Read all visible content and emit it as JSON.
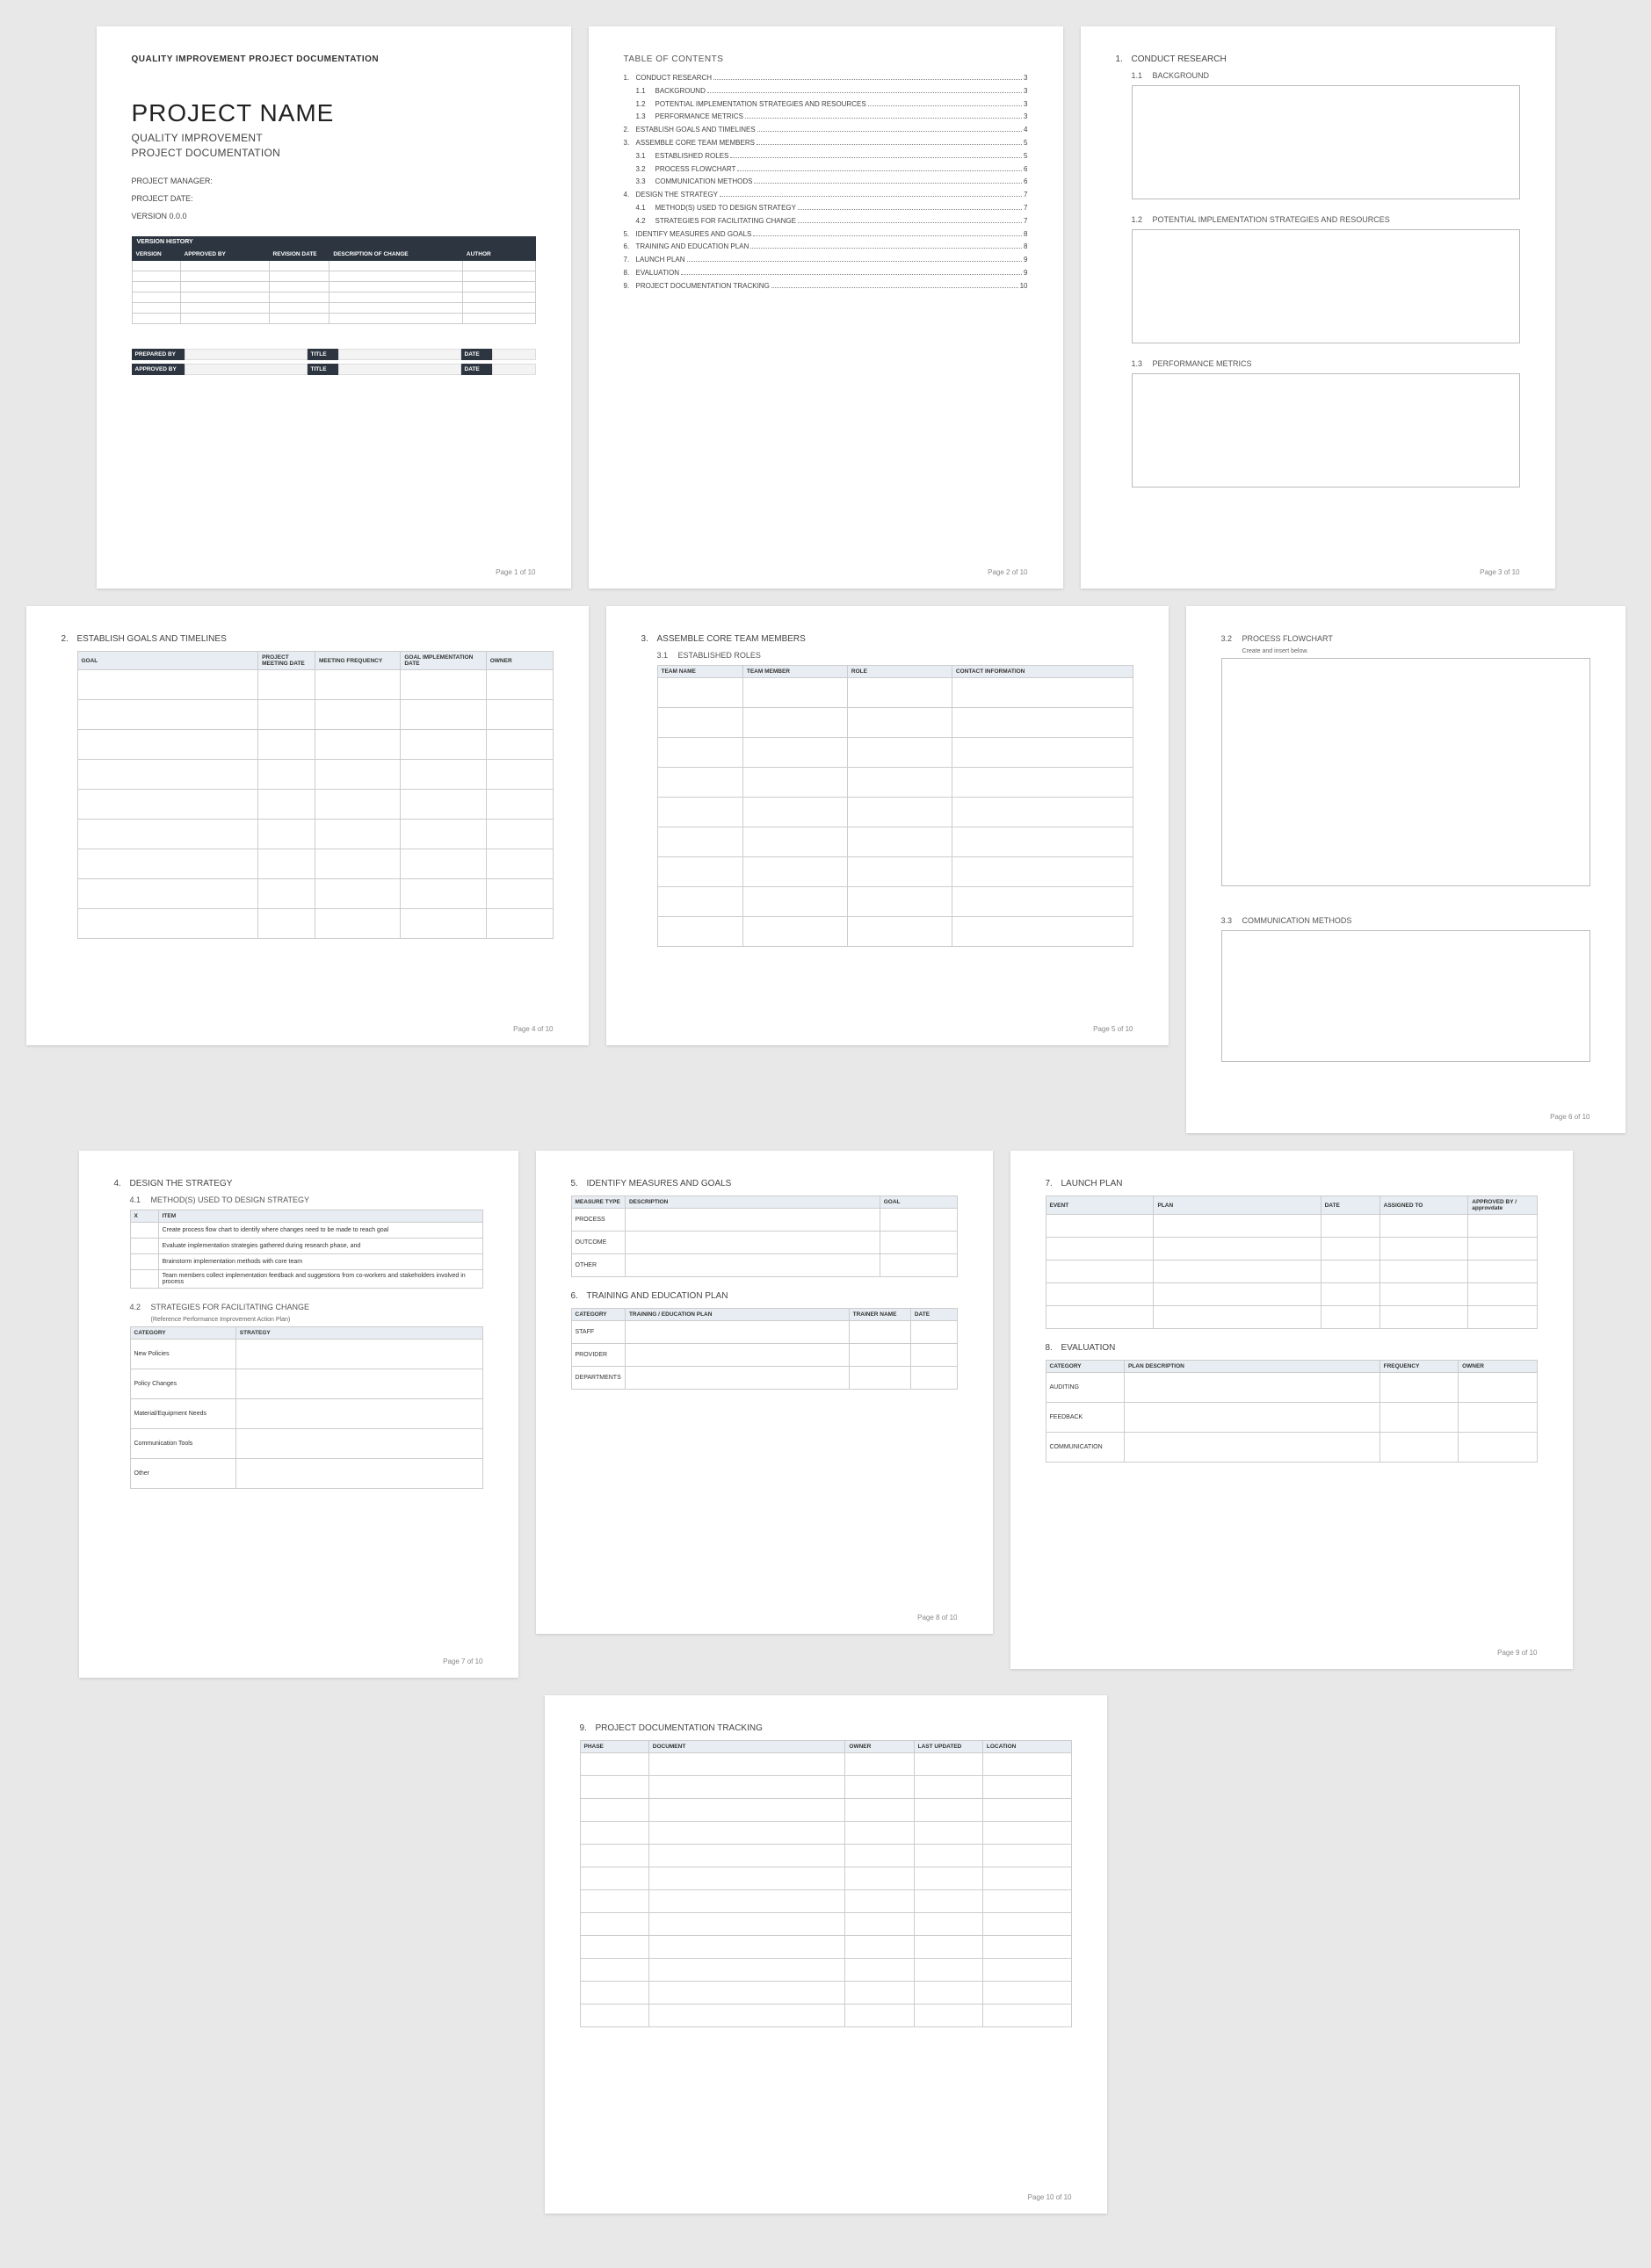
{
  "doc_type": "QUALITY IMPROVEMENT PROJECT DOCUMENTATION",
  "project_name": "PROJECT NAME",
  "project_sub1": "QUALITY IMPROVEMENT",
  "project_sub2": "PROJECT DOCUMENTATION",
  "meta": {
    "manager": "PROJECT MANAGER:",
    "date": "PROJECT DATE:",
    "version": "VERSION 0.0.0"
  },
  "version_history": {
    "title": "VERSION HISTORY",
    "cols": [
      "VERSION",
      "APPROVED BY",
      "REVISION DATE",
      "DESCRIPTION OF CHANGE",
      "AUTHOR"
    ]
  },
  "sig": {
    "prepared": "PREPARED BY",
    "approved": "APPROVED BY",
    "title": "TITLE",
    "date": "DATE"
  },
  "toc_title": "TABLE OF CONTENTS",
  "toc": [
    {
      "n": "1.",
      "t": "CONDUCT RESEARCH",
      "p": "3"
    },
    {
      "n": "1.1",
      "t": "BACKGROUND",
      "p": "3",
      "sub": true
    },
    {
      "n": "1.2",
      "t": "POTENTIAL IMPLEMENTATION STRATEGIES AND RESOURCES",
      "p": "3",
      "sub": true
    },
    {
      "n": "1.3",
      "t": "PERFORMANCE METRICS",
      "p": "3",
      "sub": true
    },
    {
      "n": "2.",
      "t": "ESTABLISH GOALS AND TIMELINES",
      "p": "4"
    },
    {
      "n": "3.",
      "t": "ASSEMBLE CORE TEAM MEMBERS",
      "p": "5"
    },
    {
      "n": "3.1",
      "t": "ESTABLISHED ROLES",
      "p": "5",
      "sub": true
    },
    {
      "n": "3.2",
      "t": "PROCESS FLOWCHART",
      "p": "6",
      "sub": true
    },
    {
      "n": "3.3",
      "t": "COMMUNICATION METHODS",
      "p": "6",
      "sub": true
    },
    {
      "n": "4.",
      "t": "DESIGN THE STRATEGY",
      "p": "7"
    },
    {
      "n": "4.1",
      "t": "METHOD(S) USED TO DESIGN STRATEGY",
      "p": "7",
      "sub": true
    },
    {
      "n": "4.2",
      "t": "STRATEGIES FOR FACILITATING CHANGE",
      "p": "7",
      "sub": true
    },
    {
      "n": "5.",
      "t": "IDENTIFY MEASURES AND GOALS",
      "p": "8"
    },
    {
      "n": "6.",
      "t": "TRAINING AND EDUCATION PLAN",
      "p": "8"
    },
    {
      "n": "7.",
      "t": "LAUNCH PLAN",
      "p": "9"
    },
    {
      "n": "8.",
      "t": "EVALUATION",
      "p": "9"
    },
    {
      "n": "9.",
      "t": "PROJECT DOCUMENTATION TRACKING",
      "p": "10"
    }
  ],
  "s1": {
    "t": "CONDUCT RESEARCH",
    "s1": "BACKGROUND",
    "s2": "POTENTIAL IMPLEMENTATION STRATEGIES AND RESOURCES",
    "s3": "PERFORMANCE METRICS"
  },
  "s2": {
    "t": "ESTABLISH GOALS AND TIMELINES",
    "cols": [
      "GOAL",
      "PROJECT MEETING DATE",
      "MEETING FREQUENCY",
      "GOAL IMPLEMENTATION DATE",
      "OWNER"
    ]
  },
  "s3": {
    "t": "ASSEMBLE CORE TEAM MEMBERS",
    "s1": "ESTABLISHED ROLES",
    "cols": [
      "TEAM NAME",
      "TEAM MEMBER",
      "ROLE",
      "CONTACT INFORMATION"
    ],
    "s2": "PROCESS FLOWCHART",
    "s2note": "Create and insert below.",
    "s3": "COMMUNICATION METHODS"
  },
  "s4": {
    "t": "DESIGN THE STRATEGY",
    "s1": "METHOD(S) USED TO DESIGN STRATEGY",
    "cols1": [
      "X",
      "ITEM"
    ],
    "items": [
      "Create process flow chart to identify where changes need to be made to reach goal",
      "Evaluate implementation strategies gathered during research phase, and",
      "Brainstorm implementation methods with core team",
      "Team members collect implementation feedback and suggestions from co-workers and stakeholders involved in process"
    ],
    "s2": "STRATEGIES FOR FACILITATING CHANGE",
    "s2note": "(Reference Performance Improvement Action Plan)",
    "cols2": [
      "CATEGORY",
      "STRATEGY"
    ],
    "cats": [
      "New Policies",
      "Policy Changes",
      "Material/Equipment Needs",
      "Communication Tools",
      "Other"
    ]
  },
  "s5": {
    "t": "IDENTIFY MEASURES AND GOALS",
    "cols": [
      "MEASURE TYPE",
      "DESCRIPTION",
      "GOAL"
    ],
    "rows": [
      "PROCESS",
      "OUTCOME",
      "OTHER"
    ]
  },
  "s6": {
    "t": "TRAINING AND EDUCATION PLAN",
    "cols": [
      "CATEGORY",
      "TRAINING / EDUCATION PLAN",
      "TRAINER NAME",
      "DATE"
    ],
    "rows": [
      "STAFF",
      "PROVIDER",
      "DEPARTMENTS"
    ]
  },
  "s7": {
    "t": "LAUNCH PLAN",
    "cols": [
      "EVENT",
      "PLAN",
      "DATE",
      "ASSIGNED TO",
      "APPROVED BY / approvdate"
    ]
  },
  "s8": {
    "t": "EVALUATION",
    "cols": [
      "CATEGORY",
      "PLAN DESCRIPTION",
      "FREQUENCY",
      "OWNER"
    ],
    "rows": [
      "AUDITING",
      "FEEDBACK",
      "COMMUNICATION"
    ]
  },
  "s9": {
    "t": "PROJECT DOCUMENTATION TRACKING",
    "cols": [
      "PHASE",
      "DOCUMENT",
      "OWNER",
      "LAST UPDATED",
      "LOCATION"
    ]
  },
  "pg": {
    "p1": "Page 1 of 10",
    "p2": "Page 2 of 10",
    "p3": "Page 3 of 10",
    "p4": "Page 4 of 10",
    "p5": "Page 5 of 10",
    "p6": "Page 6 of 10",
    "p7": "Page 7 of 10",
    "p8": "Page 8 of 10",
    "p9": "Page 9 of 10",
    "p10": "Page 10 of 10"
  }
}
